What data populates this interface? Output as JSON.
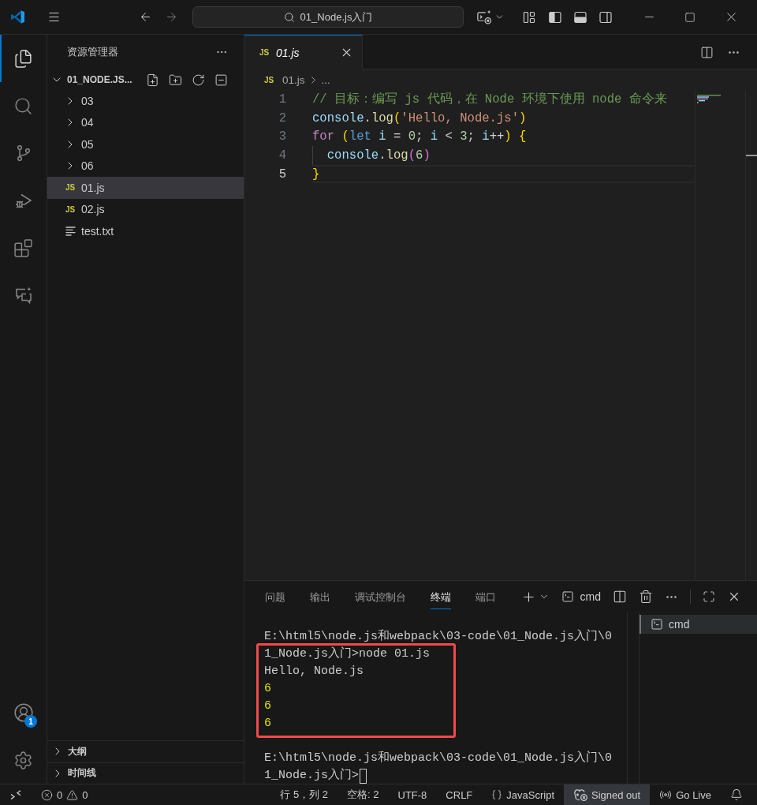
{
  "title_bar": {
    "back": {
      "disabled": false
    },
    "forward": {
      "disabled": true
    },
    "command_center": "01_Node.js入门"
  },
  "activity_bar": {
    "items": [
      {
        "kind": "explorer",
        "selected": true
      },
      {
        "kind": "search",
        "selected": false
      },
      {
        "kind": "source_control",
        "selected": false
      },
      {
        "kind": "run_debug",
        "selected": false
      },
      {
        "kind": "extensions",
        "selected": false
      },
      {
        "kind": "chat",
        "selected": false
      }
    ],
    "bottom": [
      {
        "kind": "account",
        "badge": "1"
      },
      {
        "kind": "settings"
      }
    ]
  },
  "sidebar": {
    "title": "资源管理器",
    "root": {
      "name": "01_NODE.JS...",
      "expanded": true,
      "children": [
        {
          "name": "03",
          "kind": "folder",
          "expanded": false,
          "selected": false
        },
        {
          "name": "04",
          "kind": "folder",
          "expanded": false,
          "selected": false
        },
        {
          "name": "05",
          "kind": "folder",
          "expanded": false,
          "selected": false
        },
        {
          "name": "06",
          "kind": "folder",
          "expanded": false,
          "selected": false
        },
        {
          "name": "01.js",
          "kind": "js",
          "icon": "JS",
          "selected": true
        },
        {
          "name": "02.js",
          "kind": "js",
          "icon": "JS",
          "selected": false
        },
        {
          "name": "test.txt",
          "kind": "text",
          "selected": false
        }
      ]
    },
    "sections": [
      {
        "title": "大纲",
        "expanded": false
      },
      {
        "title": "时间线",
        "expanded": false
      }
    ]
  },
  "editor": {
    "tabs": [
      {
        "label": "01.js",
        "kind": "js",
        "icon": "JS",
        "preview": true,
        "selected": true
      }
    ],
    "breadcrumb": [
      {
        "kind": "file",
        "icon": "JS",
        "label": "01.js"
      },
      {
        "kind": "more",
        "label": "..."
      }
    ],
    "lines": [
      {
        "number": "1",
        "current": false,
        "indent_guide": false,
        "tokens": [
          {
            "text": "// 目标：编写 js 代码，在 Node 环境下使用 node 命令来",
            "kind": "comment"
          }
        ]
      },
      {
        "number": "2",
        "current": false,
        "indent_guide": false,
        "tokens": [
          {
            "text": "console",
            "kind": "variable"
          },
          {
            "text": ".",
            "kind": "punct"
          },
          {
            "text": "log",
            "kind": "function"
          },
          {
            "text": "(",
            "kind": "bracket1"
          },
          {
            "text": "'Hello, Node.js'",
            "kind": "string"
          },
          {
            "text": ")",
            "kind": "bracket1"
          }
        ]
      },
      {
        "number": "3",
        "current": false,
        "indent_guide": false,
        "tokens": [
          {
            "text": "for",
            "kind": "control"
          },
          {
            "text": " (",
            "kind": "bracket1"
          },
          {
            "text": "let",
            "kind": "keyword"
          },
          {
            "text": " i",
            "kind": "variable"
          },
          {
            "text": " = ",
            "kind": "operator"
          },
          {
            "text": "0",
            "kind": "number"
          },
          {
            "text": "; ",
            "kind": "punct"
          },
          {
            "text": "i",
            "kind": "variable"
          },
          {
            "text": " < ",
            "kind": "operator"
          },
          {
            "text": "3",
            "kind": "number"
          },
          {
            "text": "; ",
            "kind": "punct"
          },
          {
            "text": "i",
            "kind": "variable"
          },
          {
            "text": "++",
            "kind": "operator"
          },
          {
            "text": ")",
            "kind": "bracket1"
          },
          {
            "text": " {",
            "kind": "bracket1"
          }
        ]
      },
      {
        "number": "4",
        "current": false,
        "indent_guide": true,
        "tokens": [
          {
            "text": "console",
            "kind": "variable"
          },
          {
            "text": ".",
            "kind": "punct"
          },
          {
            "text": "log",
            "kind": "function"
          },
          {
            "text": "(",
            "kind": "bracket2"
          },
          {
            "text": "6",
            "kind": "number"
          },
          {
            "text": ")",
            "kind": "bracket2"
          }
        ]
      },
      {
        "number": "5",
        "current": true,
        "indent_guide": false,
        "tokens": [
          {
            "text": "}",
            "kind": "bracket1"
          }
        ]
      }
    ]
  },
  "panel": {
    "tabs": [
      {
        "label": "问题",
        "selected": false
      },
      {
        "label": "输出",
        "selected": false
      },
      {
        "label": "调试控制台",
        "selected": false
      },
      {
        "label": "终端",
        "selected": true
      },
      {
        "label": "端口",
        "selected": false
      }
    ],
    "terminal_label": "cmd",
    "terminal": {
      "groups": [
        {
          "highlighted": false,
          "lines": [
            {
              "kind": "text",
              "text": "E:\\html5\\node.js和webpack\\03-code\\01_Node.js入门\\0",
              "cursor": false
            }
          ]
        },
        {
          "highlighted": true,
          "lines": [
            {
              "kind": "text",
              "text": "1_Node.js入门>node 01.js",
              "cursor": false
            },
            {
              "kind": "text",
              "text": "Hello, Node.js",
              "cursor": false
            },
            {
              "kind": "number",
              "text": "6",
              "cursor": false
            },
            {
              "kind": "number",
              "text": "6",
              "cursor": false
            },
            {
              "kind": "number",
              "text": "6",
              "cursor": false
            }
          ]
        },
        {
          "highlighted": false,
          "lines": [
            {
              "kind": "blank"
            },
            {
              "kind": "text",
              "text": "E:\\html5\\node.js和webpack\\03-code\\01_Node.js入门\\0",
              "cursor": false
            },
            {
              "kind": "text",
              "text": "1_Node.js入门>",
              "cursor": true
            }
          ]
        }
      ]
    },
    "terminal_list": [
      {
        "label": "cmd",
        "selected": true
      }
    ]
  },
  "status_bar": {
    "errors": "0",
    "warnings": "0",
    "items": [
      {
        "kind": "position",
        "label": "行 5，列 2",
        "highlighted": false
      },
      {
        "kind": "indent",
        "label": "空格: 2",
        "highlighted": false
      },
      {
        "kind": "encoding",
        "label": "UTF-8",
        "highlighted": false
      },
      {
        "kind": "eol",
        "label": "CRLF",
        "highlighted": false
      },
      {
        "kind": "language",
        "label": "JavaScript",
        "highlighted": false
      },
      {
        "kind": "account",
        "label": "Signed out",
        "highlighted": true
      },
      {
        "kind": "live",
        "label": "Go Live",
        "highlighted": false
      },
      {
        "kind": "notifications",
        "highlighted": false
      }
    ]
  }
}
